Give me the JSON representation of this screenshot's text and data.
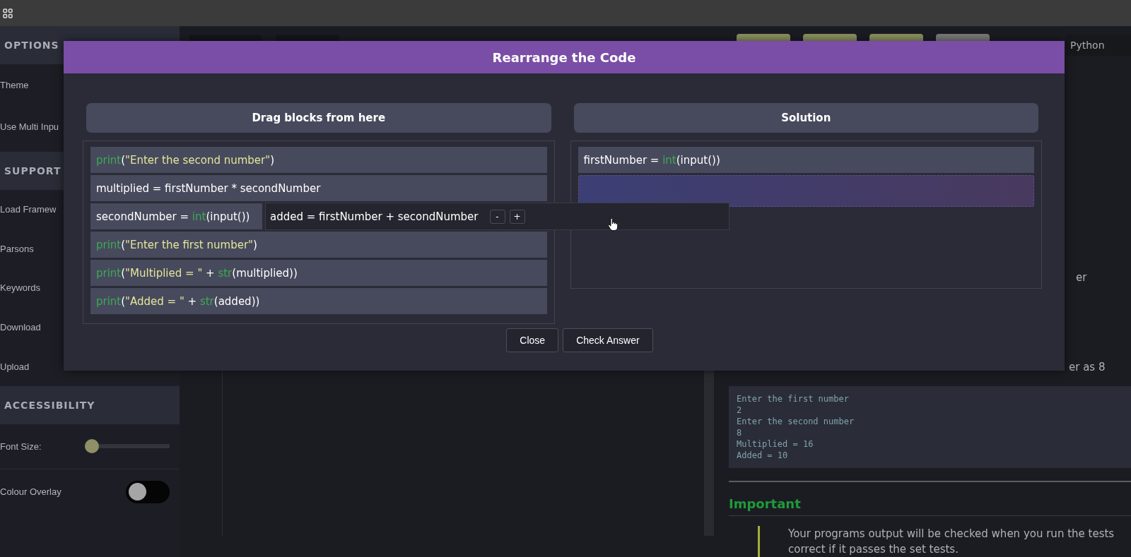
{
  "sidebar": {
    "sections": [
      {
        "title": "OPTIONS",
        "items": [
          {
            "label": "Theme"
          },
          {
            "label": "Use Multi Inpu"
          }
        ]
      },
      {
        "title": "SUPPORT",
        "items": [
          {
            "label": "Load Framew"
          },
          {
            "label": "Parsons"
          },
          {
            "label": "Keywords"
          },
          {
            "label": "Download"
          },
          {
            "label": "Upload"
          }
        ]
      },
      {
        "title": "ACCESSIBILITY",
        "items": [
          {
            "label": "Font Size:",
            "kind": "slider",
            "level": 0
          },
          {
            "label": "Colour Overlay",
            "kind": "toggle",
            "on": false
          }
        ]
      }
    ]
  },
  "right_panel": {
    "language": "Python",
    "fragment_1": "er",
    "fragment_2": "er as 8",
    "output_lines": [
      "Enter the first number",
      "2",
      "Enter the second number",
      "8",
      "Multiplied = 16",
      "Added = 10"
    ],
    "heading": "Important",
    "note_lines": [
      "Your programs output will be checked when you run the tests",
      "correct if it passes the set tests."
    ]
  },
  "modal": {
    "title": "Rearrange the Code",
    "source": {
      "title": "Drag blocks from here",
      "blocks": [
        [
          {
            "text": "print",
            "kind": "fn"
          },
          {
            "text": "(",
            "kind": "plain"
          },
          {
            "text": "\"Enter the second number\"",
            "kind": "str"
          },
          {
            "text": ")",
            "kind": "plain"
          }
        ],
        [
          {
            "text": "multiplied = firstNumber * secondNumber",
            "kind": "plain"
          }
        ],
        {
          "covered": true,
          "tokens": [
            {
              "text": "secondNumber = ",
              "kind": "plain"
            },
            {
              "text": "int",
              "kind": "fn"
            },
            {
              "text": "(input())",
              "kind": "plain"
            }
          ]
        },
        [
          {
            "text": "print",
            "kind": "fn"
          },
          {
            "text": "(",
            "kind": "plain"
          },
          {
            "text": "\"Enter the first number\"",
            "kind": "str"
          },
          {
            "text": ")",
            "kind": "plain"
          }
        ],
        [
          {
            "text": "print",
            "kind": "fn"
          },
          {
            "text": "(",
            "kind": "plain"
          },
          {
            "text": "\"Multiplied = \"",
            "kind": "str"
          },
          {
            "text": " + ",
            "kind": "plain"
          },
          {
            "text": "str",
            "kind": "fn"
          },
          {
            "text": "(multiplied))",
            "kind": "plain"
          }
        ],
        [
          {
            "text": "print",
            "kind": "fn"
          },
          {
            "text": "(",
            "kind": "plain"
          },
          {
            "text": "\"Added = \"",
            "kind": "str"
          },
          {
            "text": " + ",
            "kind": "plain"
          },
          {
            "text": "str",
            "kind": "fn"
          },
          {
            "text": "(added))",
            "kind": "plain"
          }
        ]
      ]
    },
    "solution": {
      "title": "Solution",
      "blocks": [
        [
          {
            "text": "firstNumber = ",
            "kind": "plain"
          },
          {
            "text": "int",
            "kind": "fn"
          },
          {
            "text": "(input())",
            "kind": "plain"
          }
        ]
      ]
    },
    "dragged": {
      "text": "added = firstNumber + secondNumber",
      "minus": "-",
      "plus": "+"
    },
    "buttons": [
      "Close",
      "Check Answer"
    ]
  }
}
